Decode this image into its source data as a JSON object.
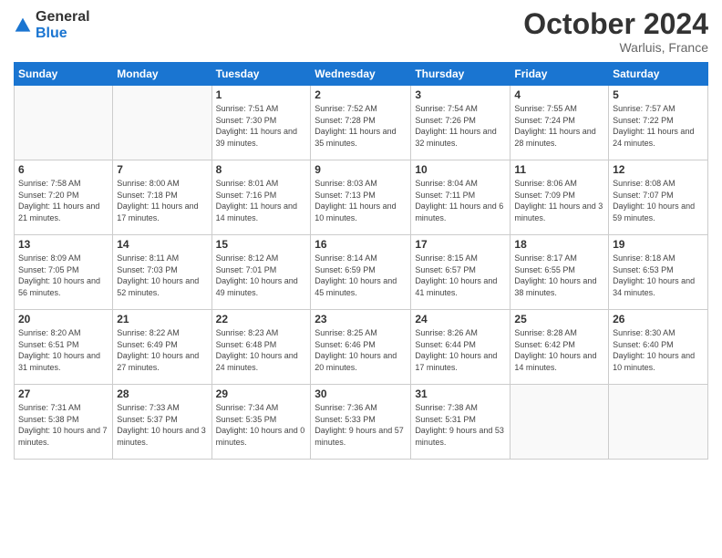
{
  "logo": {
    "general": "General",
    "blue": "Blue"
  },
  "header": {
    "month": "October 2024",
    "location": "Warluis, France"
  },
  "weekdays": [
    "Sunday",
    "Monday",
    "Tuesday",
    "Wednesday",
    "Thursday",
    "Friday",
    "Saturday"
  ],
  "weeks": [
    [
      {
        "day": "",
        "sunrise": "",
        "sunset": "",
        "daylight": ""
      },
      {
        "day": "",
        "sunrise": "",
        "sunset": "",
        "daylight": ""
      },
      {
        "day": "1",
        "sunrise": "Sunrise: 7:51 AM",
        "sunset": "Sunset: 7:30 PM",
        "daylight": "Daylight: 11 hours and 39 minutes."
      },
      {
        "day": "2",
        "sunrise": "Sunrise: 7:52 AM",
        "sunset": "Sunset: 7:28 PM",
        "daylight": "Daylight: 11 hours and 35 minutes."
      },
      {
        "day": "3",
        "sunrise": "Sunrise: 7:54 AM",
        "sunset": "Sunset: 7:26 PM",
        "daylight": "Daylight: 11 hours and 32 minutes."
      },
      {
        "day": "4",
        "sunrise": "Sunrise: 7:55 AM",
        "sunset": "Sunset: 7:24 PM",
        "daylight": "Daylight: 11 hours and 28 minutes."
      },
      {
        "day": "5",
        "sunrise": "Sunrise: 7:57 AM",
        "sunset": "Sunset: 7:22 PM",
        "daylight": "Daylight: 11 hours and 24 minutes."
      }
    ],
    [
      {
        "day": "6",
        "sunrise": "Sunrise: 7:58 AM",
        "sunset": "Sunset: 7:20 PM",
        "daylight": "Daylight: 11 hours and 21 minutes."
      },
      {
        "day": "7",
        "sunrise": "Sunrise: 8:00 AM",
        "sunset": "Sunset: 7:18 PM",
        "daylight": "Daylight: 11 hours and 17 minutes."
      },
      {
        "day": "8",
        "sunrise": "Sunrise: 8:01 AM",
        "sunset": "Sunset: 7:16 PM",
        "daylight": "Daylight: 11 hours and 14 minutes."
      },
      {
        "day": "9",
        "sunrise": "Sunrise: 8:03 AM",
        "sunset": "Sunset: 7:13 PM",
        "daylight": "Daylight: 11 hours and 10 minutes."
      },
      {
        "day": "10",
        "sunrise": "Sunrise: 8:04 AM",
        "sunset": "Sunset: 7:11 PM",
        "daylight": "Daylight: 11 hours and 6 minutes."
      },
      {
        "day": "11",
        "sunrise": "Sunrise: 8:06 AM",
        "sunset": "Sunset: 7:09 PM",
        "daylight": "Daylight: 11 hours and 3 minutes."
      },
      {
        "day": "12",
        "sunrise": "Sunrise: 8:08 AM",
        "sunset": "Sunset: 7:07 PM",
        "daylight": "Daylight: 10 hours and 59 minutes."
      }
    ],
    [
      {
        "day": "13",
        "sunrise": "Sunrise: 8:09 AM",
        "sunset": "Sunset: 7:05 PM",
        "daylight": "Daylight: 10 hours and 56 minutes."
      },
      {
        "day": "14",
        "sunrise": "Sunrise: 8:11 AM",
        "sunset": "Sunset: 7:03 PM",
        "daylight": "Daylight: 10 hours and 52 minutes."
      },
      {
        "day": "15",
        "sunrise": "Sunrise: 8:12 AM",
        "sunset": "Sunset: 7:01 PM",
        "daylight": "Daylight: 10 hours and 49 minutes."
      },
      {
        "day": "16",
        "sunrise": "Sunrise: 8:14 AM",
        "sunset": "Sunset: 6:59 PM",
        "daylight": "Daylight: 10 hours and 45 minutes."
      },
      {
        "day": "17",
        "sunrise": "Sunrise: 8:15 AM",
        "sunset": "Sunset: 6:57 PM",
        "daylight": "Daylight: 10 hours and 41 minutes."
      },
      {
        "day": "18",
        "sunrise": "Sunrise: 8:17 AM",
        "sunset": "Sunset: 6:55 PM",
        "daylight": "Daylight: 10 hours and 38 minutes."
      },
      {
        "day": "19",
        "sunrise": "Sunrise: 8:18 AM",
        "sunset": "Sunset: 6:53 PM",
        "daylight": "Daylight: 10 hours and 34 minutes."
      }
    ],
    [
      {
        "day": "20",
        "sunrise": "Sunrise: 8:20 AM",
        "sunset": "Sunset: 6:51 PM",
        "daylight": "Daylight: 10 hours and 31 minutes."
      },
      {
        "day": "21",
        "sunrise": "Sunrise: 8:22 AM",
        "sunset": "Sunset: 6:49 PM",
        "daylight": "Daylight: 10 hours and 27 minutes."
      },
      {
        "day": "22",
        "sunrise": "Sunrise: 8:23 AM",
        "sunset": "Sunset: 6:48 PM",
        "daylight": "Daylight: 10 hours and 24 minutes."
      },
      {
        "day": "23",
        "sunrise": "Sunrise: 8:25 AM",
        "sunset": "Sunset: 6:46 PM",
        "daylight": "Daylight: 10 hours and 20 minutes."
      },
      {
        "day": "24",
        "sunrise": "Sunrise: 8:26 AM",
        "sunset": "Sunset: 6:44 PM",
        "daylight": "Daylight: 10 hours and 17 minutes."
      },
      {
        "day": "25",
        "sunrise": "Sunrise: 8:28 AM",
        "sunset": "Sunset: 6:42 PM",
        "daylight": "Daylight: 10 hours and 14 minutes."
      },
      {
        "day": "26",
        "sunrise": "Sunrise: 8:30 AM",
        "sunset": "Sunset: 6:40 PM",
        "daylight": "Daylight: 10 hours and 10 minutes."
      }
    ],
    [
      {
        "day": "27",
        "sunrise": "Sunrise: 7:31 AM",
        "sunset": "Sunset: 5:38 PM",
        "daylight": "Daylight: 10 hours and 7 minutes."
      },
      {
        "day": "28",
        "sunrise": "Sunrise: 7:33 AM",
        "sunset": "Sunset: 5:37 PM",
        "daylight": "Daylight: 10 hours and 3 minutes."
      },
      {
        "day": "29",
        "sunrise": "Sunrise: 7:34 AM",
        "sunset": "Sunset: 5:35 PM",
        "daylight": "Daylight: 10 hours and 0 minutes."
      },
      {
        "day": "30",
        "sunrise": "Sunrise: 7:36 AM",
        "sunset": "Sunset: 5:33 PM",
        "daylight": "Daylight: 9 hours and 57 minutes."
      },
      {
        "day": "31",
        "sunrise": "Sunrise: 7:38 AM",
        "sunset": "Sunset: 5:31 PM",
        "daylight": "Daylight: 9 hours and 53 minutes."
      },
      {
        "day": "",
        "sunrise": "",
        "sunset": "",
        "daylight": ""
      },
      {
        "day": "",
        "sunrise": "",
        "sunset": "",
        "daylight": ""
      }
    ]
  ]
}
